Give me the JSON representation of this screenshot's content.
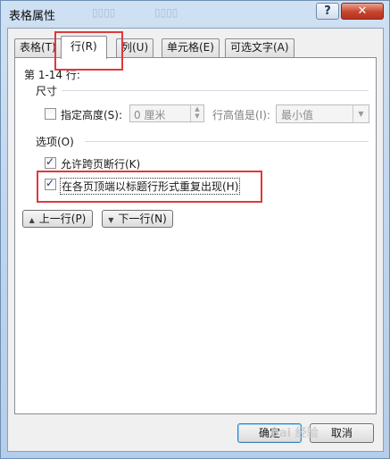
{
  "window": {
    "title": "表格属性",
    "help_label": "?",
    "close_label": "✕"
  },
  "tabs": [
    {
      "label": "表格(T)",
      "active": false
    },
    {
      "label": "行(R)",
      "active": true
    },
    {
      "label": "列(U)",
      "active": false
    },
    {
      "label": "单元格(E)",
      "active": false
    },
    {
      "label": "可选文字(A)",
      "active": false
    }
  ],
  "row_tab": {
    "rows_label": "第 1-14 行:",
    "size_section": "尺寸",
    "height_checkbox": {
      "label": "指定高度(S):",
      "checked": false
    },
    "height_value": "0 厘米",
    "height_rule_label": "行高值是(I):",
    "height_rule_value": "最小值",
    "options_section": "选项(O)",
    "allow_break": {
      "label": "允许跨页断行(K)",
      "checked": true
    },
    "repeat_header": {
      "label": "在各页顶端以标题行形式重复出现(H)",
      "checked": true
    },
    "prev_row_label": "上一行(P)",
    "next_row_label": "下一行(N)"
  },
  "footer": {
    "ok_label": "确定",
    "cancel_label": "取消"
  },
  "colors": {
    "highlight_red": "#e0383d",
    "close_red": "#c6452d"
  }
}
